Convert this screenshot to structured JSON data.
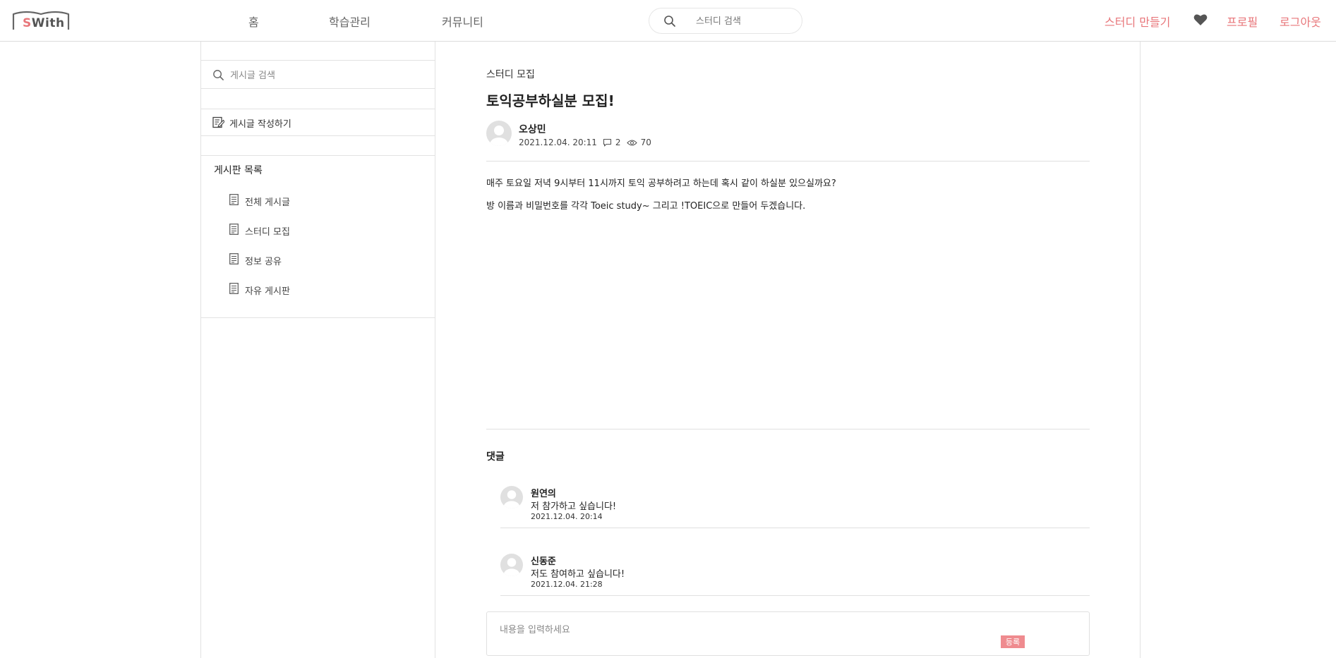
{
  "header": {
    "logo": {
      "first": "S",
      "rest": "With"
    },
    "nav": [
      "홈",
      "학습관리",
      "커뮤니티"
    ],
    "search_placeholder": "스터디 검색",
    "create_study": "스터디 만들기",
    "profile": "프로필",
    "logout": "로그아웃"
  },
  "sidebar": {
    "search_placeholder": "게시글 검색",
    "write_label": "게시글 작성하기",
    "board_title": "게시판 목록",
    "boards": [
      "전체 게시글",
      "스터디 모집",
      "정보 공유",
      "자유 게시판"
    ]
  },
  "post": {
    "category": "스터디 모집",
    "title": "토익공부하실분 모집!",
    "author": "오상민",
    "date": "2021.12.04. 20:11",
    "comment_count": "2",
    "view_count": "70",
    "body": [
      "매주 토요일 저녁 9시부터 11시까지 토익 공부하려고 하는데 혹시 같이 하실분 있으실까요?",
      "방 이름과 비밀번호를 각각 Toeic study~ 그리고 !TOEIC으로 만들어 두겠습니다."
    ]
  },
  "comments": {
    "title": "댓글",
    "items": [
      {
        "name": "원연의",
        "text": "저 참가하고 싶습니다!",
        "date": "2021.12.04. 20:14"
      },
      {
        "name": "신동준",
        "text": "저도 참여하고 싶습니다!",
        "date": "2021.12.04. 21:28"
      }
    ],
    "input_placeholder": "내용을 입력하세요",
    "submit_label": "등록"
  },
  "colors": {
    "accent": "#e8767a",
    "submit": "#ef8b8f",
    "border": "#e2e2e2"
  },
  "icons": {
    "search": "magnifier-icon",
    "heart": "heart-icon",
    "write": "edit-document-icon",
    "board": "document-icon",
    "comment": "speech-bubble-icon",
    "view": "eye-icon"
  }
}
